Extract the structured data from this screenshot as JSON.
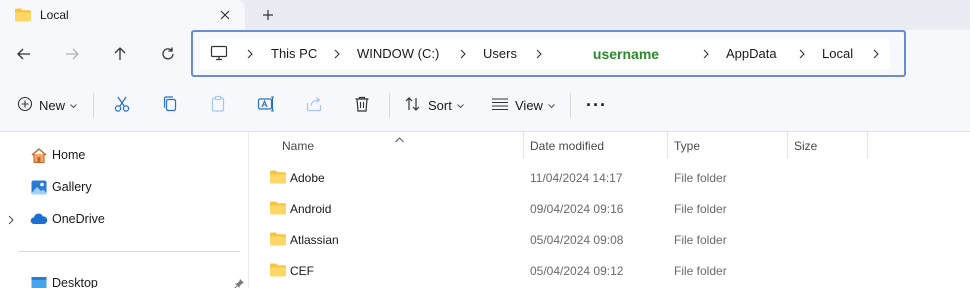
{
  "window": {
    "tab_title": "Local"
  },
  "address": {
    "crumbs": [
      "This PC",
      "WINDOW (C:)",
      "Users",
      "username",
      "AppData",
      "Local"
    ]
  },
  "commands": {
    "new_label": "New",
    "sort_label": "Sort",
    "view_label": "View",
    "more_label": "···"
  },
  "sidebar": {
    "items": [
      {
        "label": "Home"
      },
      {
        "label": "Gallery"
      },
      {
        "label": "OneDrive"
      },
      {
        "label": "Desktop"
      }
    ]
  },
  "filelist": {
    "columns": [
      "Name",
      "Date modified",
      "Type",
      "Size"
    ],
    "rows": [
      {
        "name": "Adobe",
        "date": "11/04/2024 14:17",
        "type": "File folder"
      },
      {
        "name": "Android",
        "date": "09/04/2024 09:16",
        "type": "File folder"
      },
      {
        "name": "Atlassian",
        "date": "05/04/2024 09:08",
        "type": "File folder"
      },
      {
        "name": "CEF",
        "date": "05/04/2024 09:12",
        "type": "File folder"
      }
    ]
  },
  "colors": {
    "accent_border": "#6b8bd6",
    "username_text": "#2a8a2a",
    "folder_yellow": "#f5c542"
  }
}
